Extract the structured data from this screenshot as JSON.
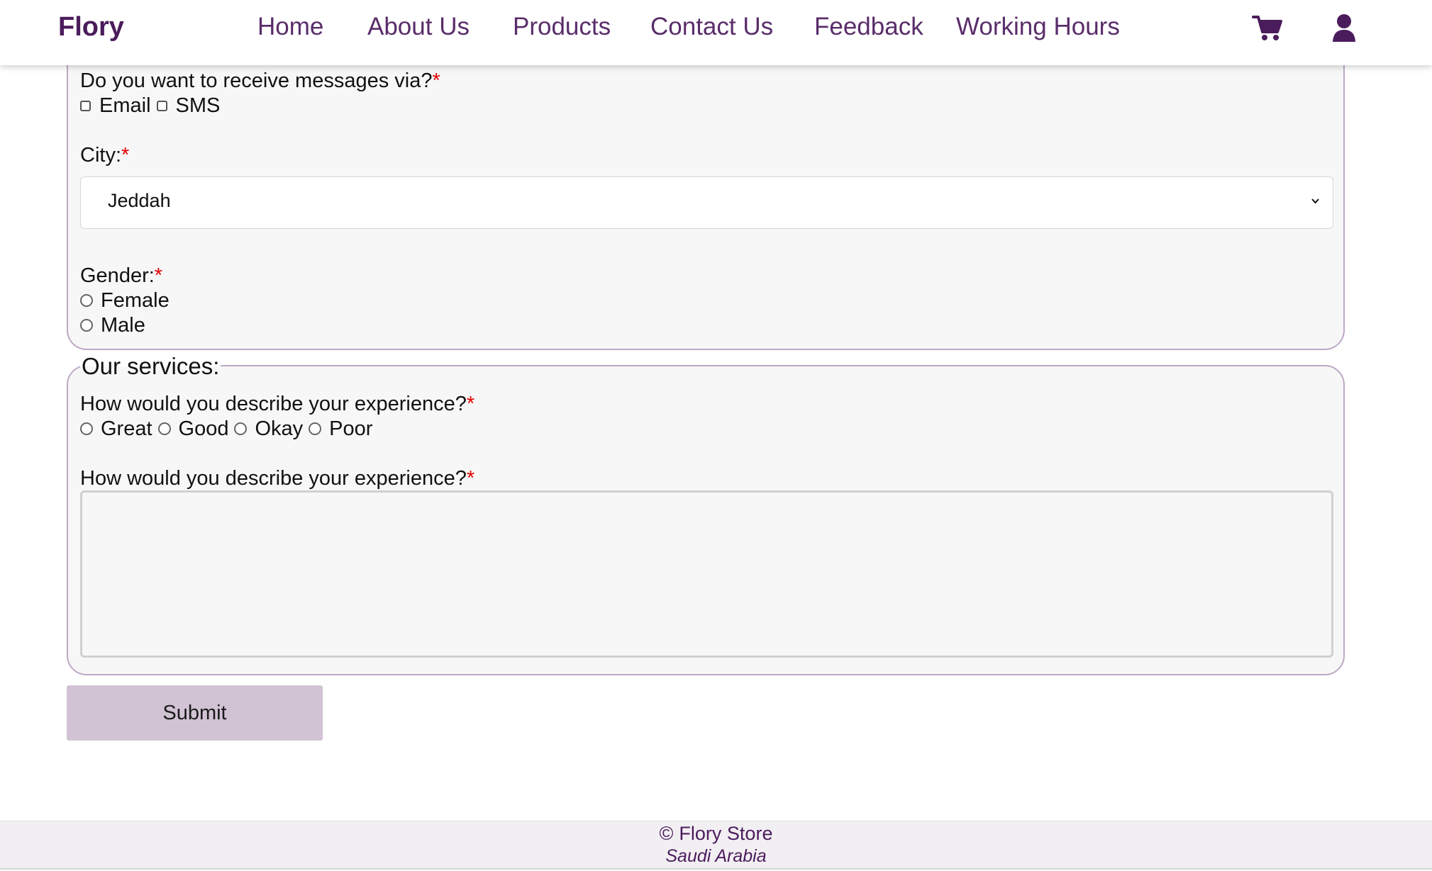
{
  "navbar": {
    "brand": "Flory",
    "links": [
      "Home",
      "About Us",
      "Products",
      "Contact Us",
      "Feedback",
      "Working Hours"
    ],
    "icons": [
      "shopping-cart-icon",
      "user-icon"
    ]
  },
  "form": {
    "messages": {
      "label": "Do you want to receive messages via?",
      "required_marker": "*",
      "options": [
        "Email",
        "SMS"
      ]
    },
    "city": {
      "label": "City:",
      "required_marker": "*",
      "selected": "Jeddah"
    },
    "gender": {
      "label": "Gender:",
      "required_marker": "*",
      "options": [
        "Female",
        "Male"
      ]
    },
    "services": {
      "legend": "Our services:",
      "experience_label": "How would you describe your experience?",
      "experience_required_marker": "*",
      "experience_options": [
        "Great",
        "Good",
        "Okay",
        "Poor"
      ],
      "textarea_label": "How would you describe your experience?",
      "textarea_required_marker": "*"
    },
    "submit_label": "Submit"
  },
  "footer": {
    "copyright_symbol": "©",
    "copyright": "Flory Store",
    "location": "Saudi Arabia"
  },
  "colors": {
    "brand": "#4b1c5c",
    "nav_link": "#5a2d6a",
    "required": "#e00000",
    "fieldset_border": "#bda9c6",
    "submit_background": "#d1c3d4",
    "footer_background": "#f2eff3"
  }
}
